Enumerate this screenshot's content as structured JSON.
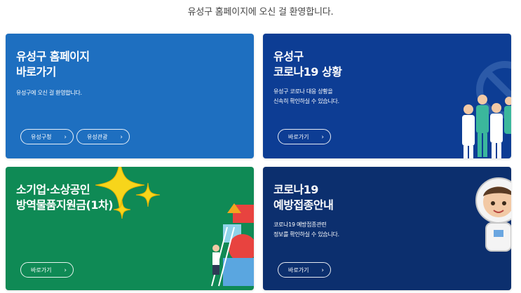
{
  "welcome_text": "유성구 홈페이지에 오신 걸 환영합니다.",
  "cards": [
    {
      "title": "유성구 홈페이지\n바로가기",
      "desc": "유성구에 오신 걸 환영합니다.",
      "buttons": [
        "유성구청",
        "유성관광"
      ],
      "bg": "#1e6fc0"
    },
    {
      "title": "유성구\n코로나19 상황",
      "desc": "유성구 코로나 대응 상황을\n신속히 확인하실 수 있습니다.",
      "buttons": [
        "바로가기"
      ],
      "bg": "#0d3d94"
    },
    {
      "title": "소기업·소상공인\n방역물품지원금(1차)",
      "desc": "",
      "buttons": [
        "바로가기"
      ],
      "bg": "#0f8a55"
    },
    {
      "title": "코로나19\n예방접종안내",
      "desc": "코로나19 예방접종관련\n정보를 확인하실 수 있습니다.",
      "buttons": [
        "바로가기"
      ],
      "bg": "#0c2f6e"
    }
  ],
  "icons": {
    "chevron": "chevron-right-icon"
  }
}
